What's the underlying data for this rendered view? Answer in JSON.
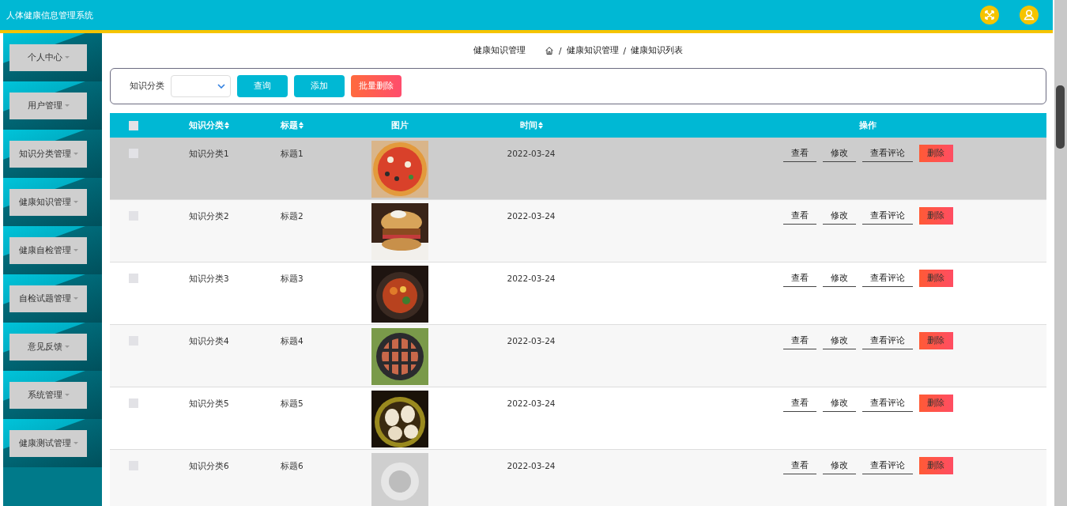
{
  "header": {
    "title": "人体健康信息管理系统"
  },
  "sidebar": {
    "items": [
      {
        "label": "个人中心"
      },
      {
        "label": "用户管理"
      },
      {
        "label": "知识分类管理"
      },
      {
        "label": "健康知识管理"
      },
      {
        "label": "健康自检管理"
      },
      {
        "label": "自检试题管理"
      },
      {
        "label": "意见反馈"
      },
      {
        "label": "系统管理"
      },
      {
        "label": "健康测试管理"
      }
    ]
  },
  "breadcrumb": {
    "title": "健康知识管理",
    "path": [
      "健康知识管理",
      "健康知识列表"
    ],
    "separator": "/"
  },
  "filter": {
    "label": "知识分类",
    "buttons": [
      {
        "label": "查询",
        "kind": "primary"
      },
      {
        "label": "添加",
        "kind": "primary"
      },
      {
        "label": "批量删除",
        "kind": "danger"
      }
    ]
  },
  "table": {
    "columns": [
      "知识分类",
      "标题",
      "图片",
      "时间",
      "操作"
    ],
    "sortable": [
      true,
      true,
      false,
      true,
      false
    ],
    "header_checked": false,
    "rows": [
      {
        "category": "知识分类1",
        "title": "标题1",
        "date": "2022-03-24",
        "checked": false,
        "highlighted": true,
        "picture": {
          "kind": "picture"
        },
        "actions": [
          {
            "label": "查看",
            "kind": "link"
          },
          {
            "label": "修改",
            "kind": "link"
          },
          {
            "label": "查看评论",
            "kind": "link"
          },
          {
            "label": "删除",
            "kind": "danger"
          }
        ]
      },
      {
        "category": "知识分类2",
        "title": "标题2",
        "date": "2022-03-24",
        "checked": false,
        "highlighted": false,
        "picture": {
          "kind": "picture"
        },
        "actions": [
          {
            "label": "查看",
            "kind": "link"
          },
          {
            "label": "修改",
            "kind": "link"
          },
          {
            "label": "查看评论",
            "kind": "link"
          },
          {
            "label": "删除",
            "kind": "danger"
          }
        ]
      },
      {
        "category": "知识分类3",
        "title": "标题3",
        "date": "2022-03-24",
        "checked": false,
        "highlighted": false,
        "picture": {
          "kind": "picture"
        },
        "actions": [
          {
            "label": "查看",
            "kind": "link"
          },
          {
            "label": "修改",
            "kind": "link"
          },
          {
            "label": "查看评论",
            "kind": "link"
          },
          {
            "label": "删除",
            "kind": "danger"
          }
        ]
      },
      {
        "category": "知识分类4",
        "title": "标题4",
        "date": "2022-03-24",
        "checked": false,
        "highlighted": false,
        "picture": {
          "kind": "picture"
        },
        "actions": [
          {
            "label": "查看",
            "kind": "link"
          },
          {
            "label": "修改",
            "kind": "link"
          },
          {
            "label": "查看评论",
            "kind": "link"
          },
          {
            "label": "删除",
            "kind": "danger"
          }
        ]
      },
      {
        "category": "知识分类5",
        "title": "标题5",
        "date": "2022-03-24",
        "checked": false,
        "highlighted": false,
        "picture": {
          "kind": "picture"
        },
        "actions": [
          {
            "label": "查看",
            "kind": "link"
          },
          {
            "label": "修改",
            "kind": "link"
          },
          {
            "label": "查看评论",
            "kind": "link"
          },
          {
            "label": "删除",
            "kind": "danger"
          }
        ]
      },
      {
        "category": "知识分类6",
        "title": "标题6",
        "date": "2022-03-24",
        "checked": false,
        "highlighted": false,
        "picture": {
          "kind": "picture"
        },
        "actions": [
          {
            "label": "查看",
            "kind": "link"
          },
          {
            "label": "修改",
            "kind": "link"
          },
          {
            "label": "查看评论",
            "kind": "link"
          },
          {
            "label": "删除",
            "kind": "danger"
          }
        ]
      }
    ]
  }
}
